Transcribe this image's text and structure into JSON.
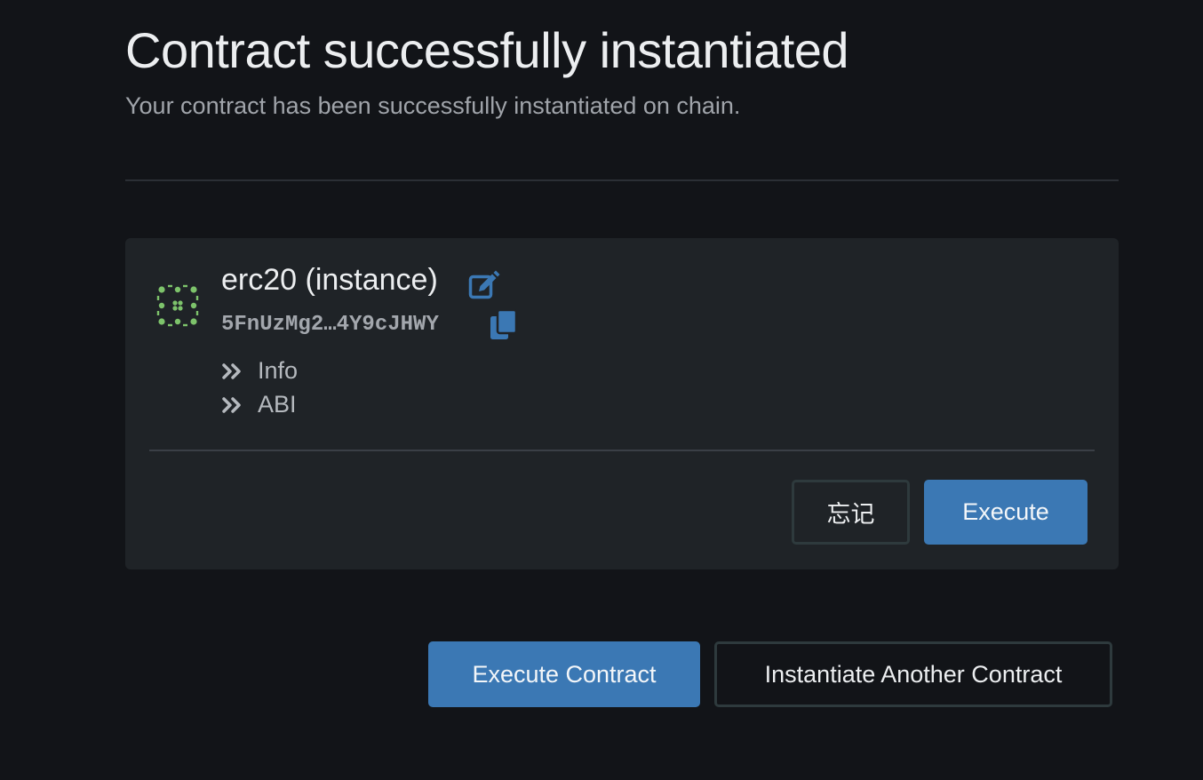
{
  "header": {
    "title": "Contract successfully instantiated",
    "subtitle": "Your contract has been successfully instantiated on chain."
  },
  "contract": {
    "name": "erc20 (instance)",
    "address": "5FnUzMg2…4Y9cJHWY",
    "identicon_color": "#7dc36b",
    "icons": {
      "edit": "edit-icon",
      "copy": "copy-icon",
      "expander": "double-chevron-right-icon"
    },
    "accent_color": "#3b78b4",
    "sections": [
      {
        "label": "Info"
      },
      {
        "label": "ABI"
      }
    ],
    "actions": {
      "forget_label": "忘记",
      "execute_label": "Execute"
    }
  },
  "footer_actions": {
    "execute_contract_label": "Execute Contract",
    "instantiate_another_label": "Instantiate Another Contract"
  }
}
